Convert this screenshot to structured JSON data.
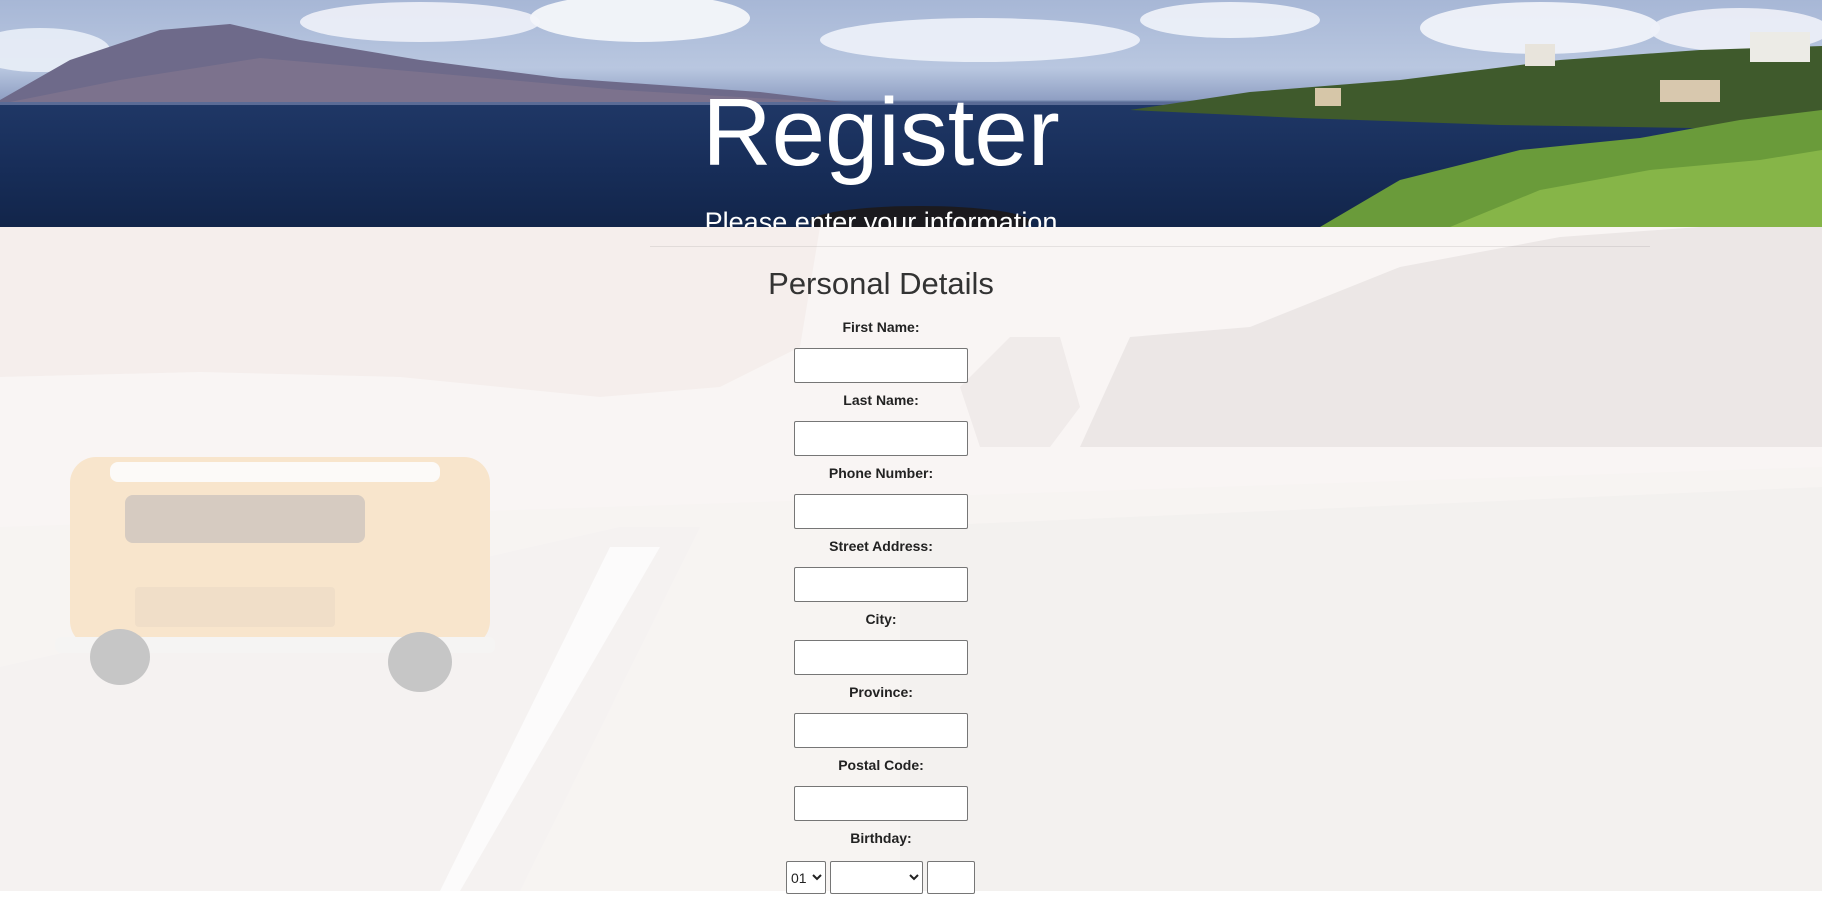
{
  "hero": {
    "title": "Register",
    "subtitle": "Please enter your information"
  },
  "form": {
    "section_title": "Personal Details",
    "fields": [
      {
        "label": "First Name:",
        "value": ""
      },
      {
        "label": "Last Name:",
        "value": ""
      },
      {
        "label": "Phone Number:",
        "value": ""
      },
      {
        "label": "Street Address:",
        "value": ""
      },
      {
        "label": "City:",
        "value": ""
      },
      {
        "label": "Province:",
        "value": ""
      },
      {
        "label": "Postal Code:",
        "value": ""
      }
    ],
    "birthday": {
      "label": "Birthday:",
      "day_selected": "01",
      "month_selected": "",
      "year_value": ""
    }
  },
  "colors": {
    "hero_ocean": "#172d58",
    "text_white": "#ffffff",
    "form_veil": "#f5f1f0"
  }
}
